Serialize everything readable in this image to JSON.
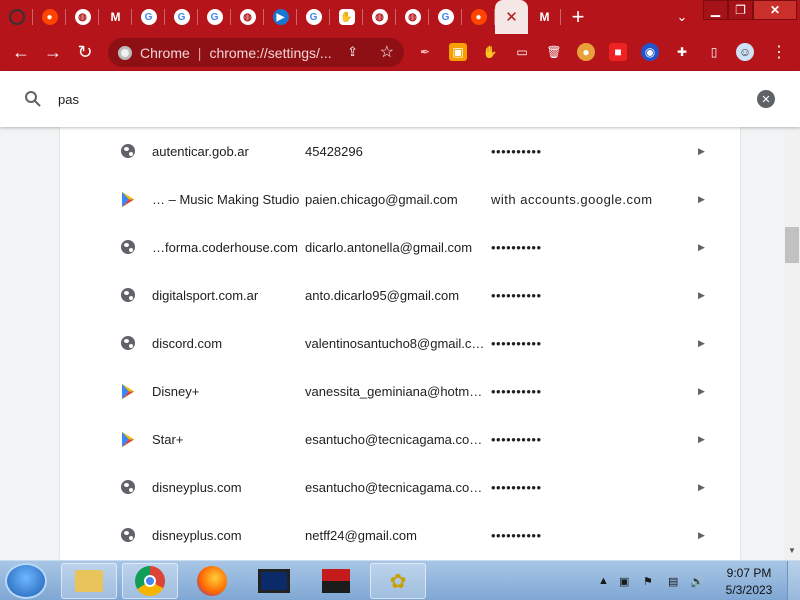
{
  "tabs": [
    {
      "icon": "github-icon",
      "kind": "github"
    },
    {
      "icon": "reddit-icon",
      "kind": "reddit"
    },
    {
      "icon": "globe-icon",
      "kind": "globe"
    },
    {
      "icon": "gmail-icon",
      "kind": "gmail"
    },
    {
      "icon": "google-icon",
      "kind": "google"
    },
    {
      "icon": "google-icon",
      "kind": "google"
    },
    {
      "icon": "google-icon",
      "kind": "google"
    },
    {
      "icon": "globe-icon",
      "kind": "globe"
    },
    {
      "icon": "play-circle-icon",
      "kind": "blue"
    },
    {
      "icon": "google-icon",
      "kind": "google"
    },
    {
      "icon": "shield-icon",
      "kind": "shield"
    },
    {
      "icon": "globe-icon",
      "kind": "globe"
    },
    {
      "icon": "globe-icon",
      "kind": "globe"
    },
    {
      "icon": "google-icon",
      "kind": "google"
    },
    {
      "icon": "reddit-icon",
      "kind": "reddit"
    }
  ],
  "omnibox": {
    "site_label": "Chrome",
    "url": "chrome://settings/..."
  },
  "search": {
    "value": "pas"
  },
  "passwords": [
    {
      "icon": "globe",
      "site": "autenticar.gob.ar",
      "user": "45428296",
      "password": "••••••••••"
    },
    {
      "icon": "play",
      "site": "… – Music Making Studio",
      "user": "paien.chicago@gmail.com",
      "password": "with accounts.google.com"
    },
    {
      "icon": "globe",
      "site": "…forma.coderhouse.com",
      "user": "dicarlo.antonella@gmail.com",
      "password": "••••••••••"
    },
    {
      "icon": "globe",
      "site": "digitalsport.com.ar",
      "user": "anto.dicarlo95@gmail.com",
      "password": "••••••••••"
    },
    {
      "icon": "globe",
      "site": "discord.com",
      "user": "valentinosantucho8@gmail.c…",
      "password": "••••••••••"
    },
    {
      "icon": "play",
      "site": "Disney+",
      "user": "vanessita_geminiana@hotm…",
      "password": "••••••••••"
    },
    {
      "icon": "play",
      "site": "Star+",
      "user": "esantucho@tecnicagama.co…",
      "password": "••••••••••"
    },
    {
      "icon": "globe",
      "site": "disneyplus.com",
      "user": "esantucho@tecnicagama.co…",
      "password": "••••••••••"
    },
    {
      "icon": "globe",
      "site": "disneyplus.com",
      "user": "netff24@gmail.com",
      "password": "••••••••••"
    }
  ],
  "taskbar": {
    "time": "9:07 PM",
    "date": "5/3/2023"
  },
  "colors": {
    "theme_red": "#b4141a",
    "taskbar_blue": "#8fb3dc"
  }
}
